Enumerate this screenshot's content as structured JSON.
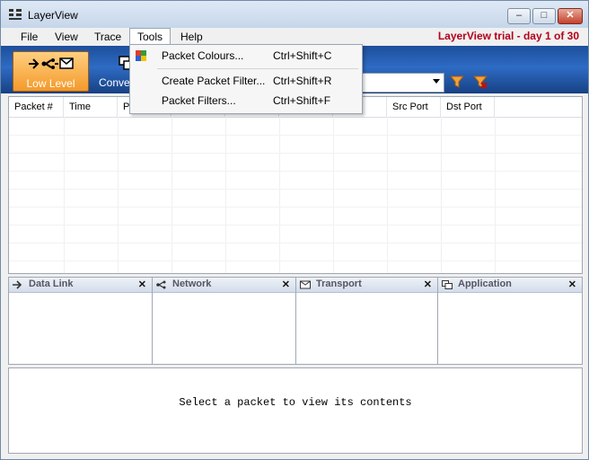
{
  "window": {
    "title": "LayerView",
    "trial_text": "LayerView trial - day 1 of 30"
  },
  "menu": [
    "File",
    "View",
    "Trace",
    "Tools",
    "Help"
  ],
  "toolbar": {
    "low_level": "Low Level",
    "conversations": "Conve"
  },
  "tools_menu": [
    {
      "label": "Packet Colours...",
      "shortcut": "Ctrl+Shift+C"
    },
    {
      "label": "Create Packet Filter...",
      "shortcut": "Ctrl+Shift+R"
    },
    {
      "label": "Packet Filters...",
      "shortcut": "Ctrl+Shift+F"
    }
  ],
  "table": {
    "headers": [
      "Packet #",
      "Time",
      "Pr",
      "",
      "",
      "",
      "P",
      "Src Port",
      "Dst Port"
    ]
  },
  "panels": [
    "Data Link",
    "Network",
    "Transport",
    "Application"
  ],
  "details": {
    "message": "Select a packet to view its contents"
  },
  "colors": {
    "toolbar": "#2e6bc4",
    "trial": "#b3001b",
    "low_level_bg": "#f49a2a"
  }
}
